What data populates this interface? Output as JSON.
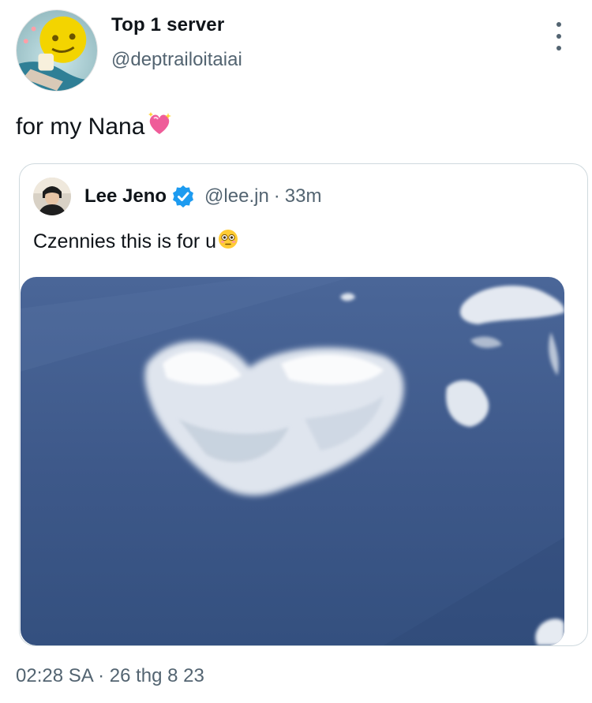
{
  "tweet": {
    "author": {
      "name": "Top 1 server",
      "handle": "@deptrailoitaiai",
      "avatar_icon": "yellow-emoji-avatar"
    },
    "text": "for my Nana",
    "text_emoji": "sparkling-heart-emoji",
    "more_icon": "vertical-ellipsis-icon",
    "timestamp": "02:28 SA · 26 thg 8 23"
  },
  "quote": {
    "author": {
      "name": "Lee Jeno",
      "handle": "@lee.jn",
      "separator": "·",
      "time": "33m",
      "verified_icon": "verified-badge-icon",
      "avatar_icon": "profile-photo-avatar"
    },
    "text": "Czennies this is for u",
    "text_emoji": "flushed-face-emoji",
    "media": {
      "description_icon": "sky-heart-cloud-photo"
    }
  },
  "colors": {
    "primary_text": "#0f1419",
    "secondary_text": "#536471",
    "border": "#cfd9de",
    "verified_blue": "#1d9bf0",
    "sky_blue": "#3f5d8f"
  }
}
